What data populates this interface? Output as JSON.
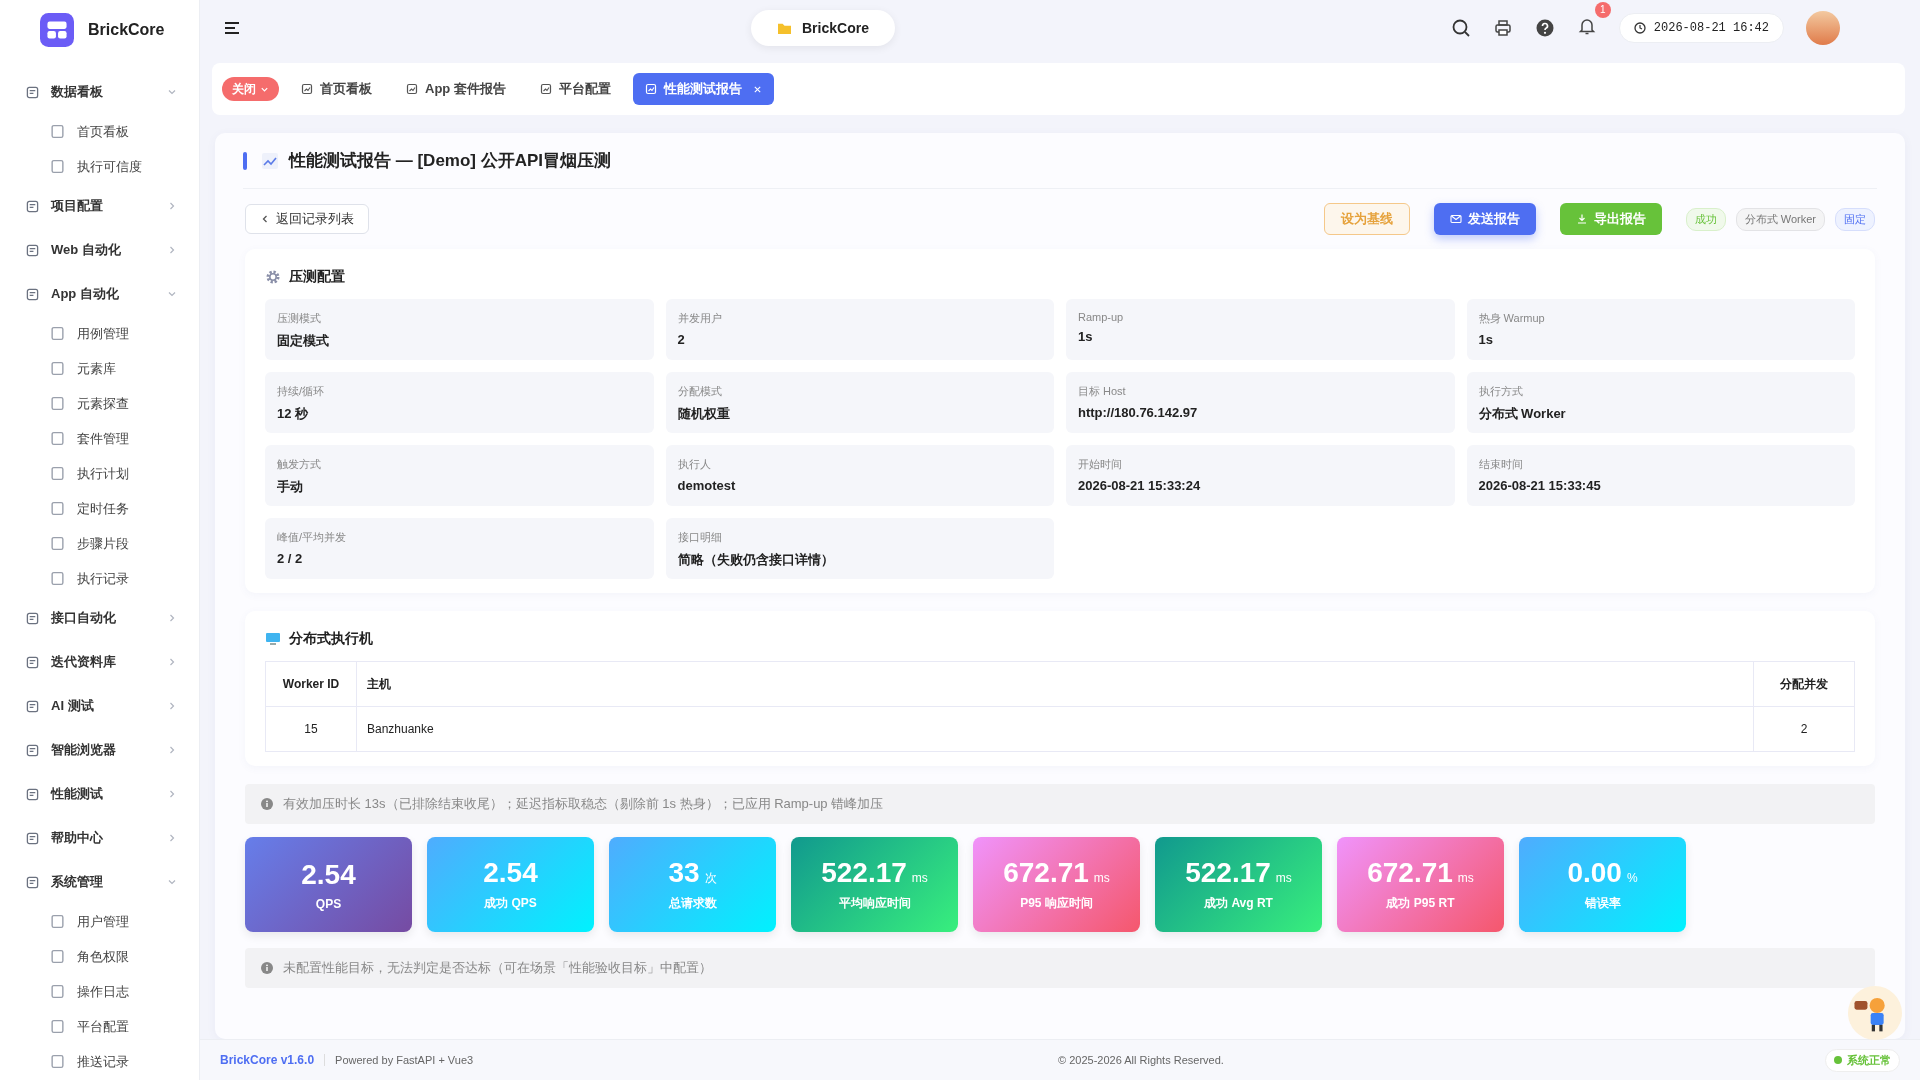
{
  "app": {
    "name": "BrickCore"
  },
  "topbar": {
    "project": "BrickCore",
    "notifications": "1",
    "datetime": "2026-08-21 16:42"
  },
  "sidebar": {
    "groups": [
      {
        "label": "数据看板",
        "expanded": true,
        "children": [
          {
            "label": "首页看板"
          },
          {
            "label": "执行可信度"
          }
        ]
      },
      {
        "label": "项目配置",
        "expanded": false
      },
      {
        "label": "Web 自动化",
        "expanded": false
      },
      {
        "label": "App 自动化",
        "expanded": true,
        "children": [
          {
            "label": "用例管理"
          },
          {
            "label": "元素库"
          },
          {
            "label": "元素探查"
          },
          {
            "label": "套件管理"
          },
          {
            "label": "执行计划"
          },
          {
            "label": "定时任务"
          },
          {
            "label": "步骤片段"
          },
          {
            "label": "执行记录"
          }
        ]
      },
      {
        "label": "接口自动化",
        "expanded": false
      },
      {
        "label": "迭代资料库",
        "expanded": false
      },
      {
        "label": "AI 测试",
        "expanded": false
      },
      {
        "label": "智能浏览器",
        "expanded": false
      },
      {
        "label": "性能测试",
        "expanded": false
      },
      {
        "label": "帮助中心",
        "expanded": false
      },
      {
        "label": "系统管理",
        "expanded": true,
        "children": [
          {
            "label": "用户管理"
          },
          {
            "label": "角色权限"
          },
          {
            "label": "操作日志"
          },
          {
            "label": "平台配置"
          },
          {
            "label": "推送记录"
          }
        ]
      }
    ]
  },
  "tabs": {
    "close_menu": "关闭",
    "items": [
      {
        "label": "首页看板",
        "selected": false
      },
      {
        "label": "App 套件报告",
        "selected": false
      },
      {
        "label": "平台配置",
        "selected": false
      },
      {
        "label": "性能测试报告",
        "selected": true
      }
    ]
  },
  "report": {
    "title": "性能测试报告 — [Demo] 公开API冒烟压测",
    "back": "返回记录列表",
    "actions": [
      {
        "label": "设为基线",
        "kind": "outline"
      },
      {
        "label": "发送报告",
        "kind": "primary"
      },
      {
        "label": "导出报告",
        "kind": "success"
      }
    ],
    "tags": [
      {
        "label": "成功",
        "kind": "success"
      },
      {
        "label": "分布式 Worker",
        "kind": "neutral"
      },
      {
        "label": "固定",
        "kind": "info"
      }
    ]
  },
  "config": {
    "title": "压测配置",
    "fields": [
      {
        "label": "压测模式",
        "value": "固定模式"
      },
      {
        "label": "并发用户",
        "value": "2"
      },
      {
        "label": "Ramp-up",
        "value": "1s"
      },
      {
        "label": "热身 Warmup",
        "value": "1s"
      },
      {
        "label": "持续/循环",
        "value": "12 秒"
      },
      {
        "label": "分配模式",
        "value": "随机权重"
      },
      {
        "label": "目标 Host",
        "value": "http://180.76.142.97"
      },
      {
        "label": "执行方式",
        "value": "分布式 Worker"
      },
      {
        "label": "触发方式",
        "value": "手动"
      },
      {
        "label": "执行人",
        "value": "demotest"
      },
      {
        "label": "开始时间",
        "value": "2026-08-21 15:33:24"
      },
      {
        "label": "结束时间",
        "value": "2026-08-21 15:33:45"
      },
      {
        "label": "峰值/平均并发",
        "value": "2 / 2"
      },
      {
        "label": "接口明细",
        "value": "简略（失败仍含接口详情）"
      }
    ]
  },
  "workers": {
    "title": "分布式执行机",
    "columns": [
      "Worker ID",
      "主机",
      "分配并发"
    ],
    "rows": [
      [
        "15",
        "Banzhuanke",
        "2"
      ]
    ]
  },
  "notice": "有效加压时长 13s（已排除结束收尾）；延迟指标取稳态（剔除前 1s 热身）；已应用 Ramp-up 错峰加压",
  "metrics": [
    {
      "value": "2.54",
      "label": "QPS",
      "kind": "indigo"
    },
    {
      "value": "2.54",
      "label": "成功 QPS",
      "kind": "cyan"
    },
    {
      "value": "33",
      "unit": "次",
      "label": "总请求数",
      "kind": "cyan"
    },
    {
      "value": "522.17",
      "unit": "ms",
      "label": "平均响应时间",
      "kind": "green"
    },
    {
      "value": "672.71",
      "unit": "ms",
      "label": "P95 响应时间",
      "kind": "pink"
    },
    {
      "value": "522.17",
      "unit": "ms",
      "label": "成功 Avg RT",
      "kind": "green"
    },
    {
      "value": "672.71",
      "unit": "ms",
      "label": "成功 P95 RT",
      "kind": "pink"
    },
    {
      "value": "0.00",
      "unit": "%",
      "label": "错误率",
      "kind": "cyan"
    }
  ],
  "target_notice": "未配置性能目标，无法判定是否达标（可在场景「性能验收目标」中配置）",
  "footer": {
    "version": "BrickCore v1.6.0",
    "powered": "Powered by FastAPI + Vue3",
    "copyright": "© 2025-2026 All Rights Reserved.",
    "status": "系统正常"
  }
}
